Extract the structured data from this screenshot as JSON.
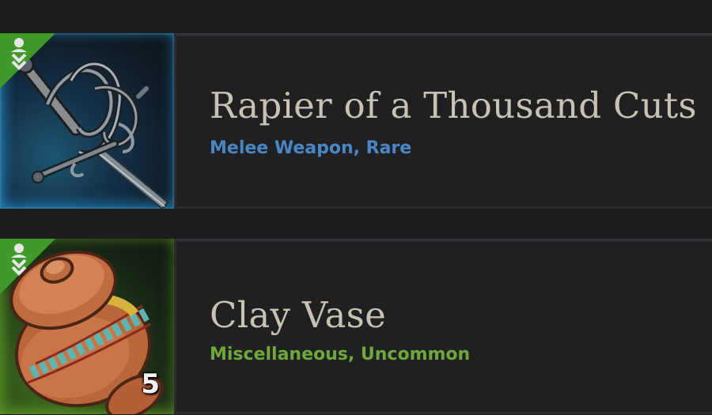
{
  "items": [
    {
      "name": "Rapier of a Thousand Cuts",
      "subtitle": "Melee Weapon, Rare",
      "subtitle_color": "#4a86c4",
      "rarity": "rare",
      "icon": "rapier-icon",
      "quantity": null
    },
    {
      "name": "Clay Vase",
      "subtitle": "Miscellaneous, Uncommon",
      "subtitle_color": "#6ea83a",
      "rarity": "uncommon",
      "icon": "clay-vase-icon",
      "quantity": "5"
    }
  ],
  "colors": {
    "background": "#1d1d20",
    "name_text": "#c8c2b4",
    "corner_badge": "#3f9a2a"
  },
  "badge_icon": "loot-drop-icon"
}
